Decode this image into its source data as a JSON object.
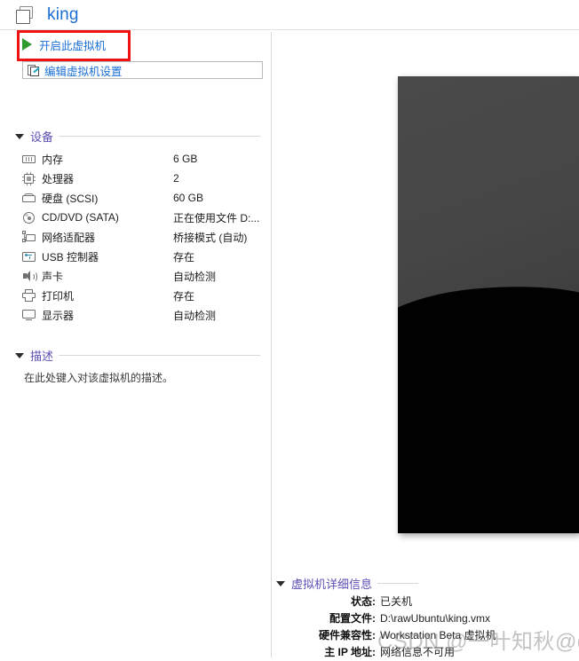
{
  "window": {
    "vm_name": "king",
    "vm_icon": "virtual-machine-icon"
  },
  "commands": {
    "power_on_label": "开启此虚拟机",
    "power_on_icon": "play-icon",
    "edit_settings_label": "编辑虚拟机设置",
    "edit_settings_icon": "edit-settings-icon"
  },
  "annotation": {
    "color": "#ef1212",
    "target": "power-on-command"
  },
  "devices_section": {
    "title": "设备",
    "caret": "caret-down-icon",
    "items": [
      {
        "icon": "memory-icon",
        "name": "内存",
        "value": "6 GB"
      },
      {
        "icon": "cpu-icon",
        "name": "处理器",
        "value": "2"
      },
      {
        "icon": "harddisk-icon",
        "name": "硬盘 (SCSI)",
        "value": "60 GB"
      },
      {
        "icon": "cd-dvd-icon",
        "name": "CD/DVD (SATA)",
        "value": "正在使用文件 D:..."
      },
      {
        "icon": "network-icon",
        "name": "网络适配器",
        "value": "桥接模式 (自动)"
      },
      {
        "icon": "usb-icon",
        "name": "USB 控制器",
        "value": "存在"
      },
      {
        "icon": "sound-card-icon",
        "name": "声卡",
        "value": "自动检测"
      },
      {
        "icon": "printer-icon",
        "name": "打印机",
        "value": "存在"
      },
      {
        "icon": "display-icon",
        "name": "显示器",
        "value": "自动检测"
      }
    ]
  },
  "description_section": {
    "title": "描述",
    "caret": "caret-down-icon",
    "placeholder_text": "在此处键入对该虚拟机的描述。"
  },
  "preview": {
    "alt": "virtual-machine-screen-preview",
    "top_color": "#4a4a4a",
    "bottom_color": "#010101"
  },
  "details_section": {
    "title": "虚拟机详细信息",
    "caret": "caret-down-icon",
    "rows": [
      {
        "label": "状态:",
        "value": "已关机"
      },
      {
        "label": "配置文件:",
        "value": "D:\\rawUbuntu\\king.vmx"
      },
      {
        "label": "硬件兼容性:",
        "value": "Workstation Beta 虚拟机"
      },
      {
        "label": "主 IP 地址:",
        "value": "网络信息不可用"
      }
    ]
  },
  "watermark": {
    "text": "CSDN @一叶知秋@qqy"
  }
}
